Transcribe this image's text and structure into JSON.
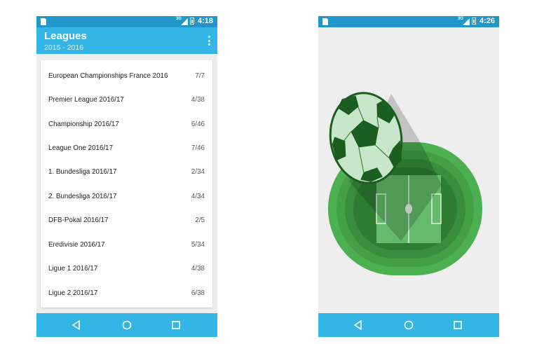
{
  "left_screen": {
    "status_time": "4:18",
    "network": "3G",
    "title": "Leagues",
    "subtitle": "2015 - 2016",
    "leagues": [
      {
        "name": "European Championships France 2016",
        "count": "7/7"
      },
      {
        "name": "Premier League 2016/17",
        "count": "4/38"
      },
      {
        "name": "Championship 2016/17",
        "count": "6/46"
      },
      {
        "name": "League One 2016/17",
        "count": "7/46"
      },
      {
        "name": "1. Bundesliga 2016/17",
        "count": "2/34"
      },
      {
        "name": "2. Bundesliga 2016/17",
        "count": "4/34"
      },
      {
        "name": "DFB-Pokal 2016/17",
        "count": "2/5"
      },
      {
        "name": "Eredivisie 2016/17",
        "count": "5/34"
      },
      {
        "name": "Ligue 1 2016/17",
        "count": "4/38"
      },
      {
        "name": "Ligue 2 2016/17",
        "count": "6/38"
      }
    ]
  },
  "right_screen": {
    "status_time": "4:26",
    "network": "3G",
    "splash_art": "soccer-ball-over-stadium-logo"
  },
  "icons": {
    "sim": "sim-card-icon",
    "signal": "signal-icon",
    "battery": "battery-icon",
    "overflow": "more-vert-icon",
    "back": "back-icon",
    "home": "home-icon",
    "recents": "recents-icon"
  },
  "colors": {
    "status_bar": "#2196c9",
    "app_bar": "#33b5e5",
    "nav_bar": "#33b5e5",
    "background": "#eeeeee",
    "stadium_green": "#4caf50",
    "ball_dark": "#1b5e20"
  }
}
